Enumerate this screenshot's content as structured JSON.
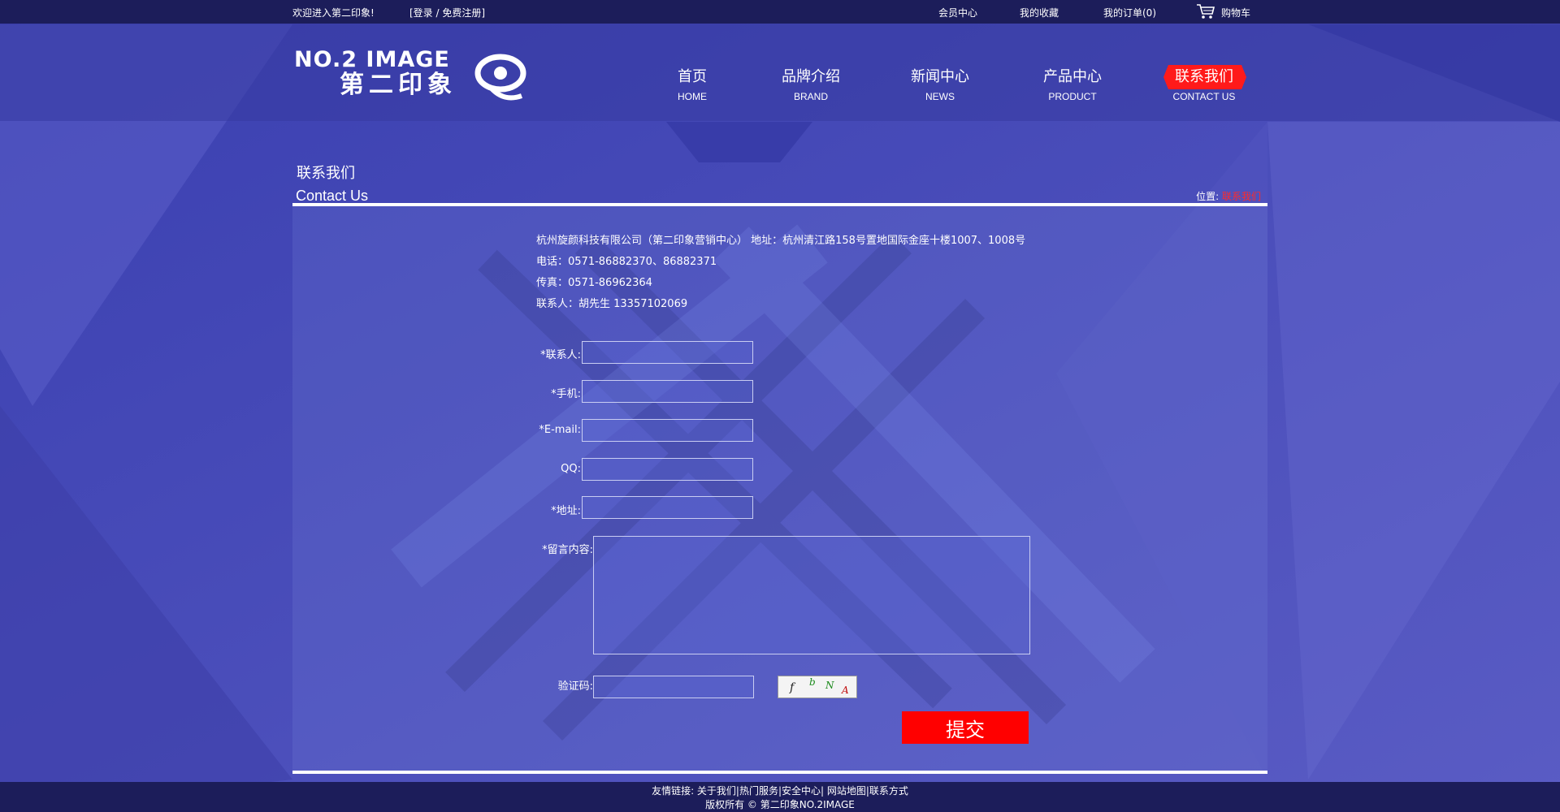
{
  "topbar": {
    "welcome": "欢迎进入第二印象!",
    "login_register": "[登录 / 免费注册]",
    "member_center": "会员中心",
    "favorites": "我的收藏",
    "orders": "我的订单(0)",
    "cart": "购物车"
  },
  "logo": {
    "en": "NO.2 IMAGE",
    "cn": "第二印象"
  },
  "nav": [
    {
      "cn": "首页",
      "en": "HOME"
    },
    {
      "cn": "品牌介绍",
      "en": "BRAND"
    },
    {
      "cn": "新闻中心",
      "en": "NEWS"
    },
    {
      "cn": "产品中心",
      "en": "PRODUCT"
    },
    {
      "cn": "联系我们",
      "en": "CONTACT US",
      "active": true
    }
  ],
  "page": {
    "title": "联系我们",
    "subtitle": "Contact Us",
    "breadcrumb_label": "位置:",
    "breadcrumb_current": "联系我们"
  },
  "contact_info": {
    "company_address": "杭州旋颜科技有限公司（第二印象营销中心） 地址：杭州清江路158号置地国际金座十楼1007、1008号",
    "phone": "电话：0571-86882370、86882371",
    "fax": "传真：0571-86962364",
    "contact_person": "联系人：胡先生 13357102069"
  },
  "form": {
    "contact_label": "*联系人:",
    "mobile_label": "*手机:",
    "email_label": "*E-mail:",
    "qq_label": "QQ:",
    "address_label": "*地址:",
    "message_label": "*留言内容:",
    "captcha_label": "验证码:",
    "contact_value": "",
    "mobile_value": "",
    "email_value": "",
    "qq_value": "",
    "address_value": "",
    "message_value": "",
    "captcha_value": "",
    "captcha_chars": [
      "f",
      "b",
      "N",
      "A"
    ],
    "submit_label": "提交"
  },
  "footer": {
    "links_line": "友情链接: 关于我们|热门服务|安全中心| 网站地图|联系方式",
    "copyright": "版权所有 © 第二印象NO.2IMAGE"
  },
  "colors": {
    "topbar_bg": "#1c1d5a",
    "page_bg": "#4a4fb8",
    "accent_red": "#ff0000",
    "breadcrumb_current": "#ff2a2a"
  }
}
